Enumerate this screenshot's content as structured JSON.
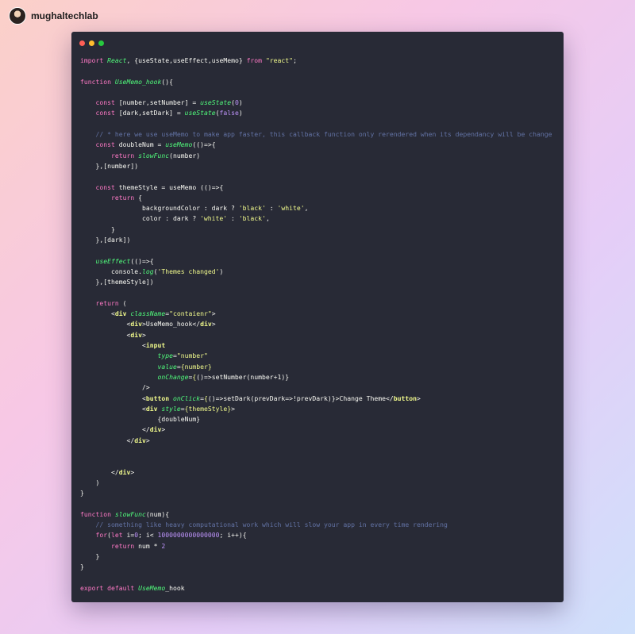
{
  "header": {
    "username": "mughaltechlab",
    "avatar_icon": "avatar-icon"
  },
  "window_controls": [
    {
      "name": "close",
      "color": "#ff5f56"
    },
    {
      "name": "minimize",
      "color": "#ffbd2e"
    },
    {
      "name": "maximize",
      "color": "#27c93f"
    }
  ],
  "theme": {
    "background": "#282a36",
    "keyword": "#ff79c6",
    "function": "#50fa7b",
    "string": "#f1fa8c",
    "number": "#bd93f9",
    "comment": "#6272a4",
    "plain": "#f8f8f2"
  },
  "code": [
    [
      [
        "kw",
        "import "
      ],
      [
        "fn",
        "React"
      ],
      [
        "pl",
        ", {useState,useEffect,useMemo} "
      ],
      [
        "kw",
        "from "
      ],
      [
        "str",
        "\"react\""
      ],
      [
        "pl",
        ";"
      ]
    ],
    [],
    [
      [
        "kw",
        "function "
      ],
      [
        "fn",
        "UseMemo_hook"
      ],
      [
        "pl",
        "(){"
      ]
    ],
    [],
    [
      [
        "pl",
        "    "
      ],
      [
        "kw",
        "const "
      ],
      [
        "pl",
        "[number,setNumber] = "
      ],
      [
        "fn",
        "useState"
      ],
      [
        "pl",
        "("
      ],
      [
        "num",
        "0"
      ],
      [
        "pl",
        ")"
      ]
    ],
    [
      [
        "pl",
        "    "
      ],
      [
        "kw",
        "const "
      ],
      [
        "pl",
        "[dark,setDark] = "
      ],
      [
        "fn",
        "useState"
      ],
      [
        "pl",
        "("
      ],
      [
        "num",
        "false"
      ],
      [
        "pl",
        ")"
      ]
    ],
    [],
    [
      [
        "pl",
        "    "
      ],
      [
        "cm",
        "// * here we use useMemo to make app faster, this callback function only rerendered when its dependancy will be change"
      ]
    ],
    [
      [
        "pl",
        "    "
      ],
      [
        "kw",
        "const "
      ],
      [
        "pl",
        "doubleNum = "
      ],
      [
        "fn",
        "useMemo"
      ],
      [
        "pl",
        "(()=>{"
      ]
    ],
    [
      [
        "pl",
        "        "
      ],
      [
        "kw",
        "return "
      ],
      [
        "fn",
        "slowFunc"
      ],
      [
        "pl",
        "(number)"
      ]
    ],
    [
      [
        "pl",
        "    },[number])"
      ]
    ],
    [],
    [
      [
        "pl",
        "    "
      ],
      [
        "kw",
        "const "
      ],
      [
        "pl",
        "themeStyle = useMemo (()=>{"
      ]
    ],
    [
      [
        "pl",
        "        "
      ],
      [
        "kw",
        "return "
      ],
      [
        "pl",
        "{"
      ]
    ],
    [
      [
        "pl",
        "                backgroundColor : dark ? "
      ],
      [
        "str",
        "'black'"
      ],
      [
        "pl",
        " : "
      ],
      [
        "str",
        "'white'"
      ],
      [
        "pl",
        ","
      ]
    ],
    [
      [
        "pl",
        "                color : dark ? "
      ],
      [
        "str",
        "'white'"
      ],
      [
        "pl",
        " : "
      ],
      [
        "str",
        "'black'"
      ],
      [
        "pl",
        ","
      ]
    ],
    [
      [
        "pl",
        "        }"
      ]
    ],
    [
      [
        "pl",
        "    },[dark])"
      ]
    ],
    [],
    [
      [
        "pl",
        "    "
      ],
      [
        "fn",
        "useEffect"
      ],
      [
        "pl",
        "(()=>{"
      ]
    ],
    [
      [
        "pl",
        "        console."
      ],
      [
        "fn",
        "log"
      ],
      [
        "pl",
        "("
      ],
      [
        "str",
        "'Themes changed'"
      ],
      [
        "pl",
        ")"
      ]
    ],
    [
      [
        "pl",
        "    },[themeStyle])"
      ]
    ],
    [],
    [
      [
        "pl",
        "    "
      ],
      [
        "kw",
        "return "
      ],
      [
        "pl",
        "("
      ]
    ],
    [
      [
        "pl",
        "        <"
      ],
      [
        "tag",
        "div "
      ],
      [
        "attr",
        "className"
      ],
      [
        "pl",
        "="
      ],
      [
        "str",
        "\"contaienr\""
      ],
      [
        "pl",
        ">"
      ]
    ],
    [
      [
        "pl",
        "            <"
      ],
      [
        "tag",
        "div"
      ],
      [
        "pl",
        ">UseMemo_hook</"
      ],
      [
        "tag",
        "div"
      ],
      [
        "pl",
        ">"
      ]
    ],
    [
      [
        "pl",
        "            <"
      ],
      [
        "tag",
        "div"
      ],
      [
        "pl",
        ">"
      ]
    ],
    [
      [
        "pl",
        "                <"
      ],
      [
        "tag",
        "input"
      ]
    ],
    [
      [
        "pl",
        "                    "
      ],
      [
        "attr",
        "type"
      ],
      [
        "pl",
        "="
      ],
      [
        "str",
        "\"number\""
      ]
    ],
    [
      [
        "pl",
        "                    "
      ],
      [
        "attr",
        "value"
      ],
      [
        "pl",
        "="
      ],
      [
        "str",
        "{number}"
      ]
    ],
    [
      [
        "pl",
        "                    "
      ],
      [
        "attr",
        "onChange"
      ],
      [
        "pl",
        "="
      ],
      [
        "str",
        "{"
      ],
      [
        "pl",
        "()=>setNumber(number+1)}"
      ]
    ],
    [
      [
        "pl",
        "                />"
      ]
    ],
    [
      [
        "pl",
        "                <"
      ],
      [
        "tag",
        "button "
      ],
      [
        "attr",
        "onClick"
      ],
      [
        "pl",
        "="
      ],
      [
        "str",
        "{"
      ],
      [
        "pl",
        "()=>setDark(prevDark=>!prevDark)}>Change Theme</"
      ],
      [
        "tag",
        "button"
      ],
      [
        "pl",
        ">"
      ]
    ],
    [
      [
        "pl",
        "                <"
      ],
      [
        "tag",
        "div "
      ],
      [
        "attr",
        "style"
      ],
      [
        "pl",
        "="
      ],
      [
        "str",
        "{themeStyle}"
      ],
      [
        "pl",
        ">"
      ]
    ],
    [
      [
        "pl",
        "                    {doubleNum}"
      ]
    ],
    [
      [
        "pl",
        "                </"
      ],
      [
        "tag",
        "div"
      ],
      [
        "pl",
        ">"
      ]
    ],
    [
      [
        "pl",
        "            </"
      ],
      [
        "tag",
        "div"
      ],
      [
        "pl",
        ">"
      ]
    ],
    [],
    [],
    [
      [
        "pl",
        "        </"
      ],
      [
        "tag",
        "div"
      ],
      [
        "pl",
        ">"
      ]
    ],
    [
      [
        "pl",
        "    )"
      ]
    ],
    [
      [
        "pl",
        "}"
      ]
    ],
    [],
    [
      [
        "kw",
        "function "
      ],
      [
        "fn",
        "slowFunc"
      ],
      [
        "pl",
        "(num){"
      ]
    ],
    [
      [
        "pl",
        "    "
      ],
      [
        "cm",
        "// something like heavy computational work which will slow your app in every time rendering"
      ]
    ],
    [
      [
        "pl",
        "    "
      ],
      [
        "kw",
        "for"
      ],
      [
        "pl",
        "("
      ],
      [
        "kw",
        "let "
      ],
      [
        "pl",
        "i="
      ],
      [
        "num",
        "0"
      ],
      [
        "pl",
        "; i< "
      ],
      [
        "num",
        "1000000000000000"
      ],
      [
        "pl",
        "; i++){"
      ]
    ],
    [
      [
        "pl",
        "        "
      ],
      [
        "kw",
        "return "
      ],
      [
        "pl",
        "num * "
      ],
      [
        "num",
        "2"
      ]
    ],
    [
      [
        "pl",
        "    }"
      ]
    ],
    [
      [
        "pl",
        "}"
      ]
    ],
    [],
    [
      [
        "kw",
        "export default "
      ],
      [
        "fn",
        "UseMemo"
      ],
      [
        "pl",
        "_hook"
      ]
    ]
  ]
}
